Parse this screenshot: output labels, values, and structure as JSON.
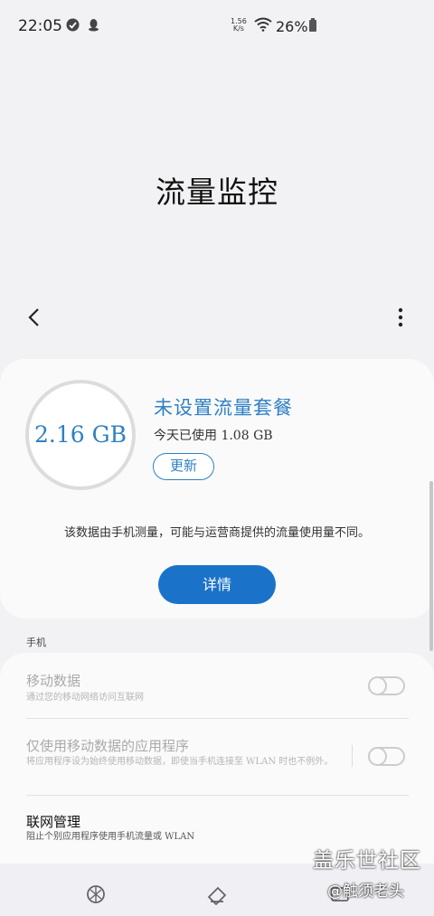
{
  "status_bar": {
    "time": "22:05",
    "net_speed_value": "1.56",
    "net_speed_unit": "K/s",
    "battery_percent": "26%"
  },
  "header": {
    "title": "流量监控"
  },
  "usage_card": {
    "total": "2.16 GB",
    "plan_title": "未设置流量套餐",
    "used_today": "今天已使用 1.08 GB",
    "update_label": "更新",
    "notice": "该数据由手机测量，可能与运营商提供的流量使用量不同。",
    "details_label": "详情",
    "accent_color": "#2f80c4",
    "button_color": "#1b73c9"
  },
  "section": {
    "label": "手机"
  },
  "settings": [
    {
      "title": "移动数据",
      "subtitle": "通过您的移动网络访问互联网",
      "toggle_on": false,
      "enabled": false
    },
    {
      "title": "仅使用移动数据的应用程序",
      "subtitle": "将应用程序设为始终使用移动数据，即使当手机连接至 WLAN 时也不例外。",
      "toggle_on": false,
      "enabled": false
    },
    {
      "title": "联网管理",
      "subtitle": "阻止个别应用程序使用手机流量或 WLAN",
      "enabled": true
    }
  ],
  "watermark": {
    "brand": "盖乐世社区",
    "user": "@触须老头"
  }
}
